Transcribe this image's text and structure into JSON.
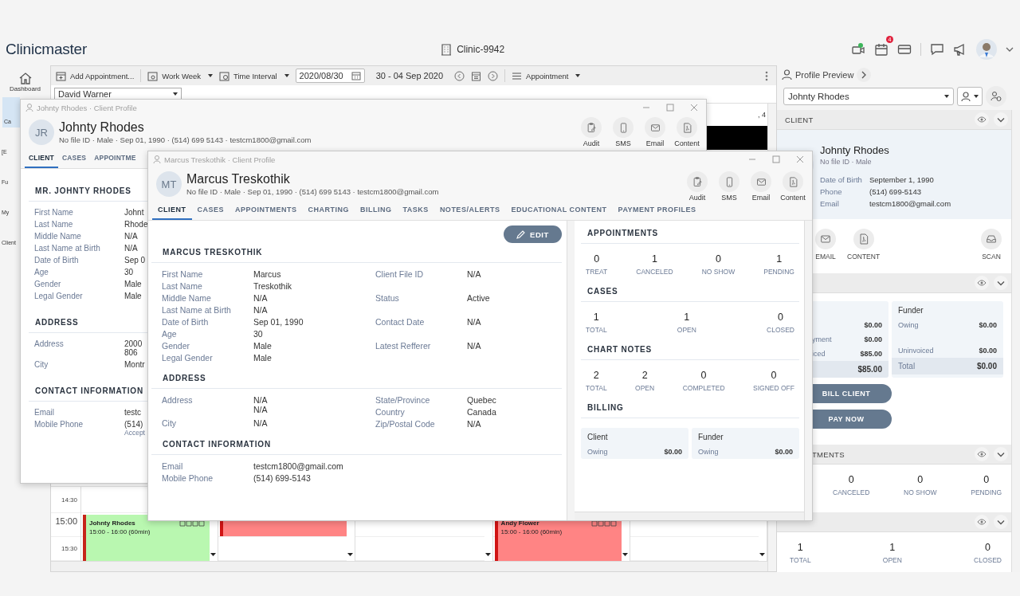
{
  "app": {
    "logo": "Clinicmaster",
    "clinic": "Clinic-9942",
    "notification_count": "4"
  },
  "sidebar": [
    {
      "label": "Dashboard",
      "selected": false,
      "kind": "home"
    },
    {
      "label": "Ca",
      "selected": true,
      "kind": "plain"
    },
    {
      "label": "[E",
      "selected": false,
      "kind": "plain"
    },
    {
      "label": "Fu",
      "selected": false,
      "kind": "plain"
    },
    {
      "label": "My",
      "selected": false,
      "kind": "plain"
    },
    {
      "label": "Client",
      "selected": false,
      "kind": "plain"
    }
  ],
  "toolbar": {
    "add": "Add Appointment...",
    "view": "Work Week",
    "interval": "Time Interval",
    "date": "2020/08/30",
    "range": "30 - 04 Sep 2020",
    "mode": "Appointment"
  },
  "calendar": {
    "provider": "David Warner",
    "header_fragment": ", 4",
    "times": [
      {
        "label": "14:30",
        "kind": "half"
      },
      {
        "label": "15:00",
        "kind": "hour"
      },
      {
        "label": "15:30",
        "kind": "half"
      }
    ],
    "days": [
      {
        "more": true,
        "events": [
          {
            "kind": "appointment",
            "name": "Johnty Rhodes",
            "time": "15:00 - 16:00 (60min)",
            "color": "#b9f7b0"
          }
        ]
      },
      {
        "more": true,
        "events": [
          {
            "kind": "clipped",
            "color": "#ff8484"
          }
        ]
      },
      {
        "more": true
      },
      {
        "more": true,
        "events": [
          {
            "kind": "appointment",
            "name": "Andy Flower",
            "time": "15:00 - 16:00 (60min)",
            "color": "#ff8484"
          }
        ]
      },
      {
        "more": true
      }
    ]
  },
  "preview": {
    "title": "Profile Preview",
    "client_select": "Johnty Rhodes",
    "sections": [
      {
        "kind": "client",
        "title": "CLIENT",
        "name": "Johnty Rhodes",
        "sub": "No file ID · Male",
        "fields": [
          {
            "label": "Date of Birth",
            "value": "September 1, 1990"
          },
          {
            "label": "Phone",
            "value": "(514) 699-5143"
          },
          {
            "label": "Email",
            "value": "testcm1800@gmail.com"
          }
        ],
        "actions": [
          {
            "label": "EMAIL",
            "kind": "email"
          },
          {
            "label": "CONTENT",
            "kind": "content"
          },
          {
            "label": "SCAN",
            "kind": "scan"
          }
        ]
      },
      {
        "kind": "billing",
        "cards": [
          {
            "rows": [
              {
                "kind": "line",
                "value": "$0.00"
              },
              {
                "kind": "line",
                "label": "yment",
                "value": "$0.00"
              },
              {
                "kind": "line",
                "label": "iced",
                "value": "$85.00"
              },
              {
                "kind": "total",
                "value": "$85.00"
              }
            ]
          },
          {
            "title": "Funder",
            "rows": [
              {
                "kind": "line",
                "label": "Owing",
                "value": "$0.00"
              },
              {
                "kind": "spaced",
                "label": "Uninvoiced",
                "value": "$0.00"
              },
              {
                "kind": "total",
                "label": "Total",
                "value": "$0.00"
              }
            ]
          }
        ],
        "buttons": [
          "BILL CLIENT",
          "PAY NOW"
        ]
      },
      {
        "kind": "stats",
        "title": "TMENTS",
        "stats": [
          {
            "value": "0",
            "label": "CANCELED"
          },
          {
            "value": "0",
            "label": "NO SHOW"
          },
          {
            "value": "0",
            "label": "PENDING"
          }
        ]
      },
      {
        "kind": "stats",
        "stats": [
          {
            "value": "1",
            "label": "TOTAL"
          },
          {
            "value": "1",
            "label": "OPEN"
          },
          {
            "value": "0",
            "label": "CLOSED"
          }
        ]
      }
    ]
  },
  "back_window": {
    "title": "Johnty Rhodes · Client Profile",
    "initials": "JR",
    "name": "Johnty Rhodes",
    "sub": "No file ID · Male · Sep 01, 1990 · (514) 699 5143 · testcm1800@gmail.com",
    "actions": [
      {
        "label": "Audit",
        "kind": "audit"
      },
      {
        "label": "SMS",
        "kind": "sms"
      },
      {
        "label": "Email",
        "kind": "email"
      },
      {
        "label": "Content",
        "kind": "content"
      }
    ],
    "tabs": [
      {
        "label": "CLIENT",
        "selected": true
      },
      {
        "label": "CASES",
        "selected": false
      },
      {
        "label": "APPOINTME",
        "selected": false
      }
    ],
    "sections": [
      {
        "title": "MR. JOHNTY RHODES",
        "fields": [
          {
            "label": "First Name",
            "lines": [
              "Johnt"
            ]
          },
          {
            "label": "Last Name",
            "lines": [
              "Rhode"
            ]
          },
          {
            "label": "Middle Name",
            "lines": [
              "N/A"
            ]
          },
          {
            "label": "Last Name at Birth",
            "lines": [
              "N/A"
            ]
          },
          {
            "label": "Date of Birth",
            "lines": [
              "Sep 0"
            ]
          },
          {
            "label": "Age",
            "lines": [
              "30"
            ]
          },
          {
            "label": "Gender",
            "lines": [
              "Male"
            ]
          },
          {
            "label": "Legal Gender",
            "lines": [
              "Male"
            ]
          }
        ]
      },
      {
        "title": "ADDRESS",
        "fields": [
          {
            "label": "Address",
            "lines": [
              "2000",
              "806"
            ]
          },
          {
            "label": "City",
            "lines": [
              "Montr"
            ]
          }
        ]
      },
      {
        "title": "CONTACT INFORMATION",
        "fields": [
          {
            "label": "Email",
            "lines": [
              "testc"
            ]
          },
          {
            "label": "Mobile Phone",
            "lines": [
              "(514)"
            ],
            "note": "Accept"
          }
        ]
      }
    ]
  },
  "front_window": {
    "title": "Marcus Treskothik · Client Profile",
    "initials": "MT",
    "name": "Marcus Treskothik",
    "sub": "No file ID · Male · Sep 01, 1990 · (514) 699 5143 · testcm1800@gmail.com",
    "actions": [
      {
        "label": "Audit",
        "kind": "audit"
      },
      {
        "label": "SMS",
        "kind": "sms"
      },
      {
        "label": "Email",
        "kind": "email"
      },
      {
        "label": "Content",
        "kind": "content"
      }
    ],
    "tabs": [
      {
        "label": "CLIENT",
        "selected": true
      },
      {
        "label": "CASES",
        "selected": false
      },
      {
        "label": "APPOINTMENTS",
        "selected": false
      },
      {
        "label": "CHARTING",
        "selected": false
      },
      {
        "label": "BILLING",
        "selected": false
      },
      {
        "label": "TASKS",
        "selected": false
      },
      {
        "label": "NOTES/ALERTS",
        "selected": false
      },
      {
        "label": "EDUCATIONAL CONTENT",
        "selected": false
      },
      {
        "label": "PAYMENT PROFILES",
        "selected": false
      }
    ],
    "edit": "EDIT",
    "sections": [
      {
        "title": "MARCUS TRESKOTHIK",
        "columns": [
          [
            {
              "label": "First Name",
              "lines": [
                "Marcus"
              ]
            },
            {
              "label": "Last Name",
              "lines": [
                "Treskothik"
              ]
            },
            {
              "label": "Middle Name",
              "lines": [
                "N/A"
              ]
            },
            {
              "label": "Last Name at Birth",
              "lines": [
                "N/A"
              ]
            },
            {
              "label": "Date of Birth",
              "lines": [
                "Sep 01, 1990"
              ]
            },
            {
              "label": "Age",
              "lines": [
                "30"
              ]
            },
            {
              "label": "Gender",
              "lines": [
                "Male"
              ]
            },
            {
              "label": "Legal Gender",
              "lines": [
                "Male"
              ]
            }
          ],
          [
            {
              "label": "Client File ID",
              "lines": [
                "N/A"
              ]
            },
            {
              "label": "Status",
              "lines": [
                "Active"
              ]
            },
            {
              "label": "Contact Date",
              "lines": [
                "N/A"
              ]
            },
            {
              "label": "Latest Refferer",
              "lines": [
                "N/A"
              ]
            }
          ]
        ]
      },
      {
        "title": "ADDRESS",
        "columns": [
          [
            {
              "label": "Address",
              "lines": [
                "N/A",
                "N/A"
              ]
            },
            {
              "label": "City",
              "lines": [
                "N/A"
              ]
            }
          ],
          [
            {
              "label": "State/Province",
              "lines": [
                "Quebec"
              ]
            },
            {
              "label": "Country",
              "lines": [
                "Canada"
              ]
            },
            {
              "label": "Zip/Postal Code",
              "lines": [
                "N/A"
              ]
            }
          ]
        ]
      },
      {
        "title": "CONTACT INFORMATION",
        "columns": [
          [
            {
              "label": "Email",
              "lines": [
                "testcm1800@gmail.com"
              ]
            },
            {
              "label": "Mobile Phone",
              "lines": [
                "(514) 699-5143"
              ]
            }
          ]
        ]
      }
    ],
    "summary": [
      {
        "title": "APPOINTMENTS",
        "stats": [
          {
            "value": "0",
            "label": "TREAT"
          },
          {
            "value": "1",
            "label": "CANCELED"
          },
          {
            "value": "0",
            "label": "NO SHOW"
          },
          {
            "value": "1",
            "label": "PENDING"
          }
        ]
      },
      {
        "title": "CASES",
        "stats": [
          {
            "value": "1",
            "label": "TOTAL"
          },
          {
            "value": "1",
            "label": "OPEN"
          },
          {
            "value": "0",
            "label": "CLOSED"
          }
        ]
      },
      {
        "title": "CHART NOTES",
        "stats": [
          {
            "value": "2",
            "label": "TOTAL"
          },
          {
            "value": "2",
            "label": "OPEN"
          },
          {
            "value": "0",
            "label": "COMPLETED"
          },
          {
            "value": "0",
            "label": "SIGNED OFF"
          }
        ]
      },
      {
        "title": "BILLING",
        "cards": [
          {
            "title": "Client",
            "rows": [
              {
                "label": "Owing",
                "value": "$0.00"
              }
            ]
          },
          {
            "title": "Funder",
            "rows": [
              {
                "label": "Owing",
                "value": "$0.00"
              }
            ]
          }
        ]
      }
    ]
  }
}
